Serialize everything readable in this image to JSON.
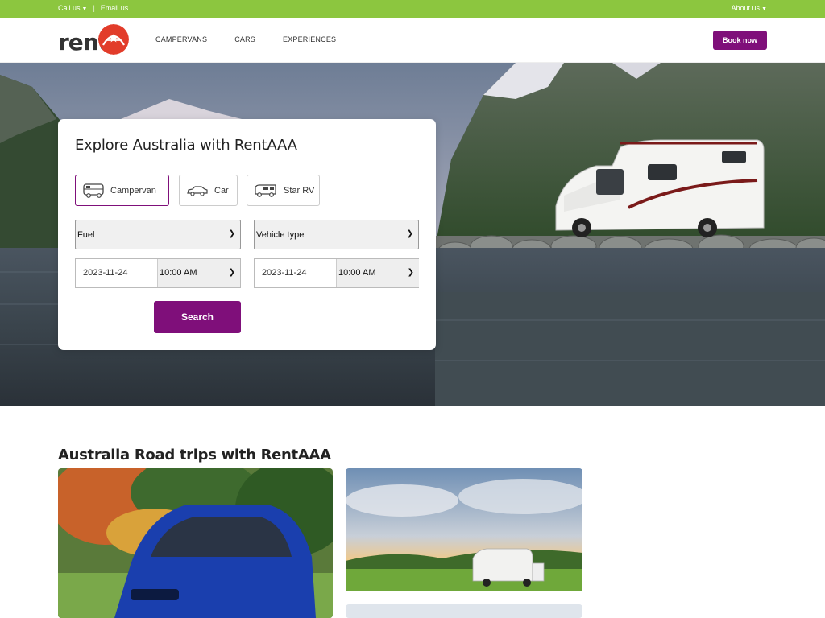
{
  "topbar": {
    "call_us": "Call us",
    "email_us": "Email us",
    "about_us": "About us",
    "background_color": "#8cc63f"
  },
  "header": {
    "logo_text": "rent",
    "logo_badge_letter": "A",
    "nav": [
      "CAMPERVANS",
      "CARS",
      "EXPERIENCES"
    ],
    "book_now": "Book now",
    "accent_color": "#7f0f7a"
  },
  "search": {
    "title": "Explore Australia with RentAAA",
    "vehicle_types": [
      {
        "label": "Campervan",
        "icon": "campervan-icon",
        "selected": true
      },
      {
        "label": "Car",
        "icon": "car-icon",
        "selected": false
      },
      {
        "label": "Star RV",
        "icon": "rv-icon",
        "selected": false
      }
    ],
    "fuel": "Fuel",
    "vehicle_type": "Vehicle type",
    "pickup_date": "2023-11-24",
    "pickup_time": "10:00 AM",
    "dropoff_date": "2023-11-24",
    "dropoff_time": "10:00 AM",
    "search_button": "Search"
  },
  "section": {
    "title": "Australia Road trips with RentAAA"
  }
}
